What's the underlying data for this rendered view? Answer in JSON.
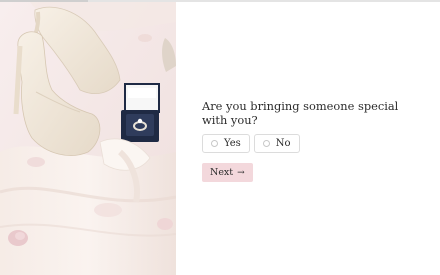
{
  "progress": {
    "fraction": 0.2
  },
  "hero_image": {
    "description_icon": "wedding-shoes-ring-photo",
    "palette": {
      "background": "#f6ecec",
      "silk": "#f3e6e1",
      "shoe": "#f1e8dc",
      "box": "#1f2a44",
      "petal": "#e9c9cc"
    }
  },
  "question": {
    "text": "Are you bringing someone special with you?"
  },
  "options": [
    {
      "label": "Yes",
      "selected": false
    },
    {
      "label": "No",
      "selected": false
    }
  ],
  "next_button": {
    "label": "Next",
    "icon": "arrow-right-icon",
    "color": "#f3d8dc"
  }
}
